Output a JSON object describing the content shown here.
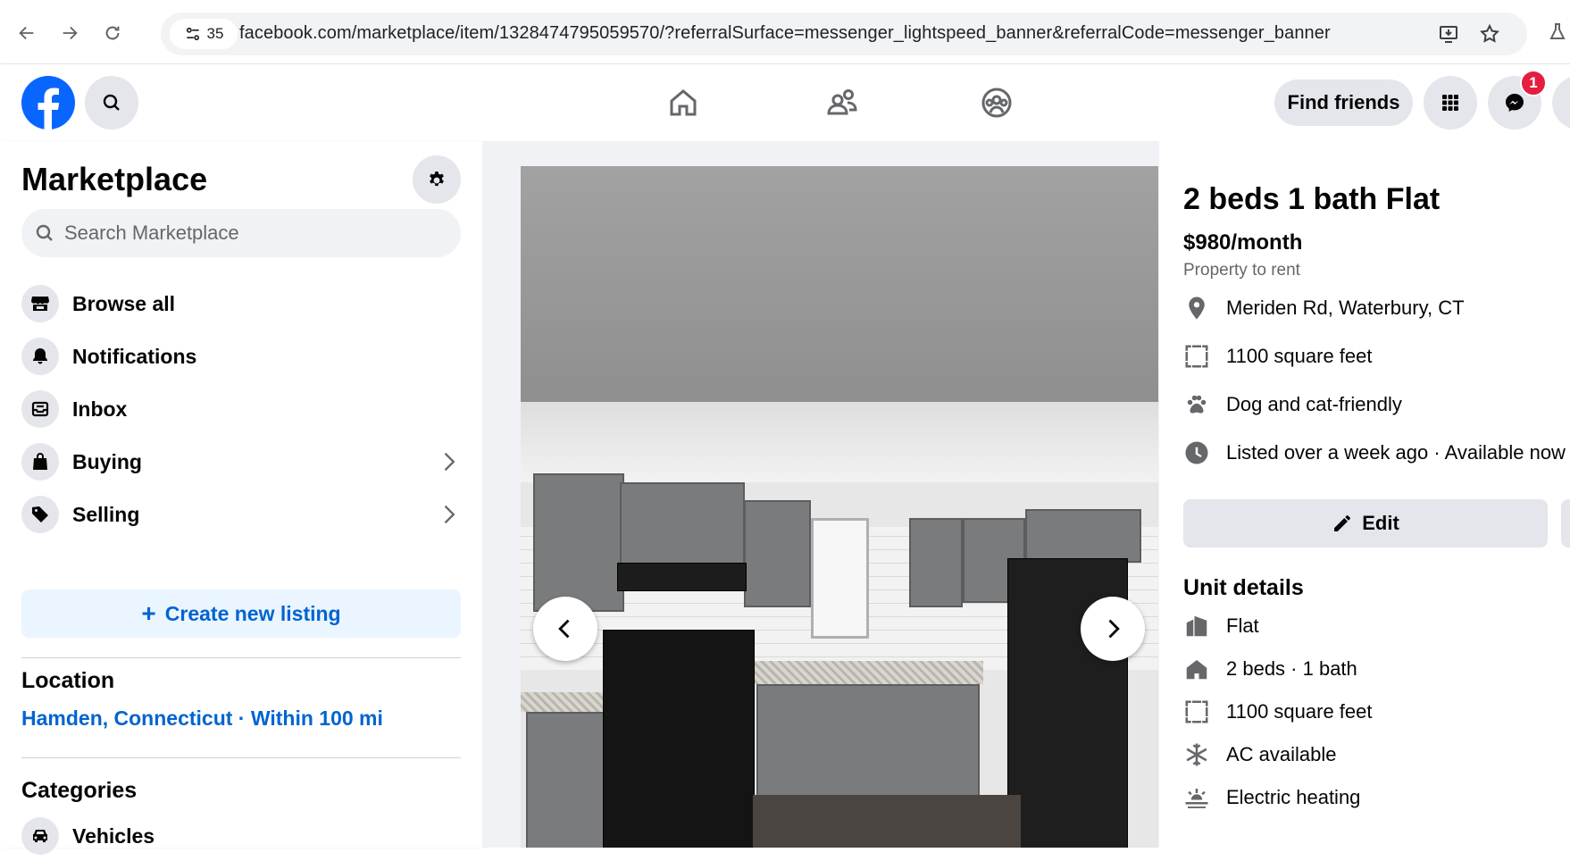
{
  "browser": {
    "site_info_count": "35",
    "url": "facebook.com/marketplace/item/1328474795059570/?referralSurface=messenger_lightspeed_banner&referralCode=messenger_banner"
  },
  "header": {
    "find_friends": "Find friends",
    "messenger_badge": "1"
  },
  "sidebar": {
    "title": "Marketplace",
    "search_placeholder": "Search Marketplace",
    "items": [
      {
        "label": "Browse all"
      },
      {
        "label": "Notifications"
      },
      {
        "label": "Inbox"
      },
      {
        "label": "Buying"
      },
      {
        "label": "Selling"
      }
    ],
    "create_label": "Create new listing",
    "location_heading": "Location",
    "location_value": "Hamden, Connecticut · Within 100 mi",
    "categories_heading": "Categories",
    "categories": [
      {
        "label": "Vehicles"
      }
    ]
  },
  "listing": {
    "title": "2 beds 1 bath Flat",
    "price": "$980/month",
    "subtitle": "Property to rent",
    "facts": [
      {
        "icon": "location-pin-icon",
        "text": "Meriden Rd, Waterbury, CT"
      },
      {
        "icon": "area-icon",
        "text": "1100 square feet"
      },
      {
        "icon": "paw-icon",
        "text": "Dog and cat-friendly"
      },
      {
        "icon": "clock-icon",
        "text": "Listed over a week ago · Available now"
      }
    ],
    "edit_label": "Edit",
    "unit_heading": "Unit details",
    "unit_details": [
      {
        "icon": "building-icon",
        "text": "Flat"
      },
      {
        "icon": "house-icon",
        "text": "2 beds · 1 bath"
      },
      {
        "icon": "area-icon",
        "text": "1100 square feet"
      },
      {
        "icon": "snowflake-icon",
        "text": "AC available"
      },
      {
        "icon": "heat-icon",
        "text": "Electric heating"
      }
    ]
  },
  "colors": {
    "facebook_blue": "#0866ff",
    "link_blue": "#0064d1",
    "badge_red": "#e41e3f"
  }
}
